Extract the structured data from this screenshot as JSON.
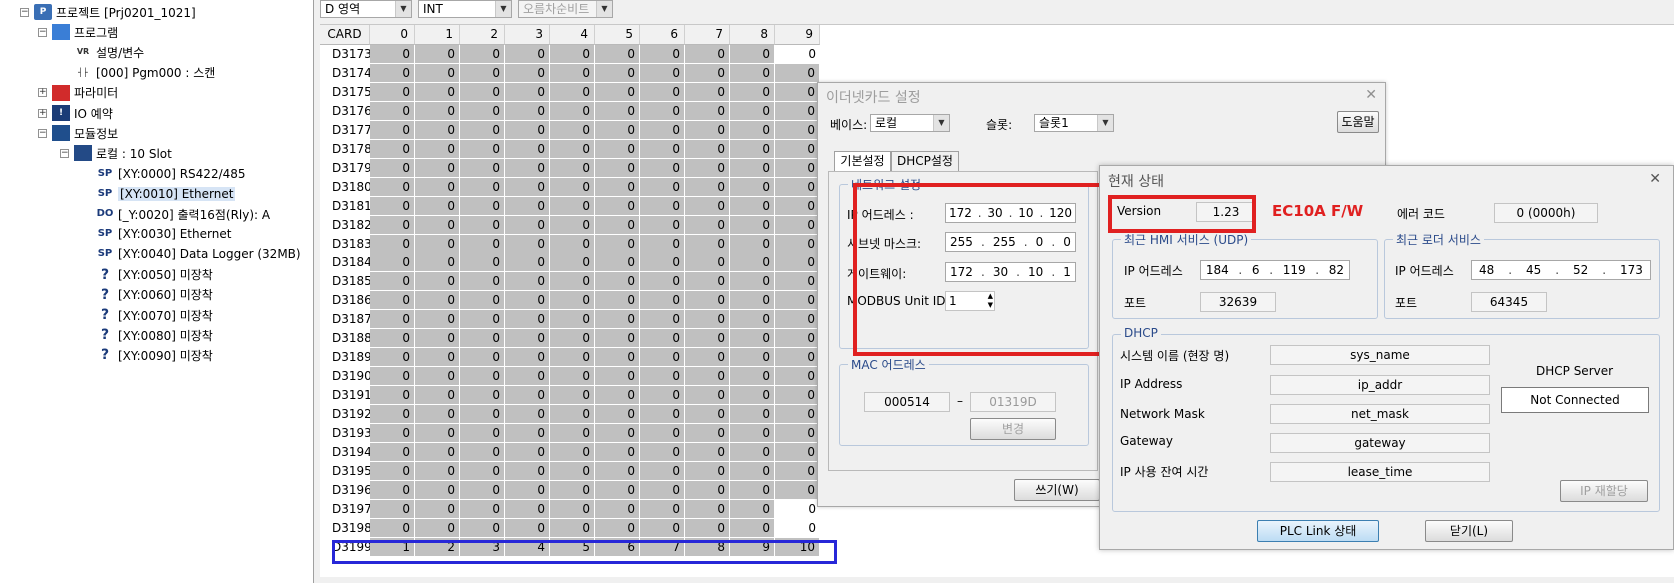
{
  "tree": {
    "items": [
      {
        "label": "프로젝트 [Prj0201_1021]",
        "icon": "project-icon",
        "box": "−"
      },
      {
        "label": "프로그램",
        "icon": "program-folder-icon",
        "box": "−"
      },
      {
        "label": "설명/변수",
        "icon": "variable-icon",
        "box": ""
      },
      {
        "label": "[000] Pgm000 : 스캔",
        "icon": "ladder-icon",
        "box": ""
      },
      {
        "label": "파라미터",
        "icon": "parameter-icon",
        "box": "+"
      },
      {
        "label": "IO 예약",
        "icon": "io-icon",
        "box": "+"
      },
      {
        "label": "모듈정보",
        "icon": "module-icon",
        "box": "−"
      },
      {
        "label": "로컬 : 10 Slot",
        "icon": "slot-icon",
        "box": "−"
      },
      {
        "label": "[XY:0000] RS422/485",
        "icon": "sp-icon",
        "box": ""
      },
      {
        "label": "[XY:0010] Ethernet",
        "icon": "sp-icon",
        "box": ""
      },
      {
        "label": "[_Y:0020] 출력16점(Rly): A",
        "icon": "do-icon",
        "box": ""
      },
      {
        "label": "[XY:0030] Ethernet",
        "icon": "sp-icon",
        "box": ""
      },
      {
        "label": "[XY:0040] Data Logger (32MB)",
        "icon": "sp-icon",
        "box": ""
      },
      {
        "label": "[XY:0050] 미장착",
        "icon": "question-icon",
        "box": ""
      },
      {
        "label": "[XY:0060] 미장착",
        "icon": "question-icon",
        "box": ""
      },
      {
        "label": "[XY:0070] 미장착",
        "icon": "question-icon",
        "box": ""
      },
      {
        "label": "[XY:0080] 미장착",
        "icon": "question-icon",
        "box": ""
      },
      {
        "label": "[XY:0090] 미장착",
        "icon": "question-icon",
        "box": ""
      }
    ],
    "selected_index": 9
  },
  "toolbar": {
    "area": "D 영역",
    "type": "INT",
    "order": "오름차순비트"
  },
  "grid": {
    "card_header": "CARD",
    "columns": [
      "0",
      "1",
      "2",
      "3",
      "4",
      "5",
      "6",
      "7",
      "8",
      "9"
    ],
    "rows": [
      {
        "addr": "D3173",
        "values": [
          "0",
          "0",
          "0",
          "0",
          "0",
          "0",
          "0",
          "0",
          "0",
          "0"
        ]
      },
      {
        "addr": "D3174",
        "values": [
          "0",
          "0",
          "0",
          "0",
          "0",
          "0",
          "0",
          "0",
          "0",
          "0"
        ]
      },
      {
        "addr": "D3175",
        "values": [
          "0",
          "0",
          "0",
          "0",
          "0",
          "0",
          "0",
          "0",
          "0",
          "0"
        ]
      },
      {
        "addr": "D3176",
        "values": [
          "0",
          "0",
          "0",
          "0",
          "0",
          "0",
          "0",
          "0",
          "0",
          "0"
        ]
      },
      {
        "addr": "D3177",
        "values": [
          "0",
          "0",
          "0",
          "0",
          "0",
          "0",
          "0",
          "0",
          "0",
          "0"
        ]
      },
      {
        "addr": "D3178",
        "values": [
          "0",
          "0",
          "0",
          "0",
          "0",
          "0",
          "0",
          "0",
          "0",
          "0"
        ]
      },
      {
        "addr": "D3179",
        "values": [
          "0",
          "0",
          "0",
          "0",
          "0",
          "0",
          "0",
          "0",
          "0",
          "0"
        ]
      },
      {
        "addr": "D3180",
        "values": [
          "0",
          "0",
          "0",
          "0",
          "0",
          "0",
          "0",
          "0",
          "0",
          "0"
        ]
      },
      {
        "addr": "D3181",
        "values": [
          "0",
          "0",
          "0",
          "0",
          "0",
          "0",
          "0",
          "0",
          "0",
          "0"
        ]
      },
      {
        "addr": "D3182",
        "values": [
          "0",
          "0",
          "0",
          "0",
          "0",
          "0",
          "0",
          "0",
          "0",
          "0"
        ]
      },
      {
        "addr": "D3183",
        "values": [
          "0",
          "0",
          "0",
          "0",
          "0",
          "0",
          "0",
          "0",
          "0",
          "0"
        ]
      },
      {
        "addr": "D3184",
        "values": [
          "0",
          "0",
          "0",
          "0",
          "0",
          "0",
          "0",
          "0",
          "0",
          "0"
        ]
      },
      {
        "addr": "D3185",
        "values": [
          "0",
          "0",
          "0",
          "0",
          "0",
          "0",
          "0",
          "0",
          "0",
          "0"
        ]
      },
      {
        "addr": "D3186",
        "values": [
          "0",
          "0",
          "0",
          "0",
          "0",
          "0",
          "0",
          "0",
          "0",
          "0"
        ]
      },
      {
        "addr": "D3187",
        "values": [
          "0",
          "0",
          "0",
          "0",
          "0",
          "0",
          "0",
          "0",
          "0",
          "0"
        ]
      },
      {
        "addr": "D3188",
        "values": [
          "0",
          "0",
          "0",
          "0",
          "0",
          "0",
          "0",
          "0",
          "0",
          "0"
        ]
      },
      {
        "addr": "D3189",
        "values": [
          "0",
          "0",
          "0",
          "0",
          "0",
          "0",
          "0",
          "0",
          "0",
          "0"
        ]
      },
      {
        "addr": "D3190",
        "values": [
          "0",
          "0",
          "0",
          "0",
          "0",
          "0",
          "0",
          "0",
          "0",
          "0"
        ]
      },
      {
        "addr": "D3191",
        "values": [
          "0",
          "0",
          "0",
          "0",
          "0",
          "0",
          "0",
          "0",
          "0",
          "0"
        ]
      },
      {
        "addr": "D3192",
        "values": [
          "0",
          "0",
          "0",
          "0",
          "0",
          "0",
          "0",
          "0",
          "0",
          "0"
        ]
      },
      {
        "addr": "D3193",
        "values": [
          "0",
          "0",
          "0",
          "0",
          "0",
          "0",
          "0",
          "0",
          "0",
          "0"
        ]
      },
      {
        "addr": "D3194",
        "values": [
          "0",
          "0",
          "0",
          "0",
          "0",
          "0",
          "0",
          "0",
          "0",
          "0"
        ]
      },
      {
        "addr": "D3195",
        "values": [
          "0",
          "0",
          "0",
          "0",
          "0",
          "0",
          "0",
          "0",
          "0",
          "0"
        ]
      },
      {
        "addr": "D3196",
        "values": [
          "0",
          "0",
          "0",
          "0",
          "0",
          "0",
          "0",
          "0",
          "0",
          "0"
        ]
      },
      {
        "addr": "D3197",
        "values": [
          "0",
          "0",
          "0",
          "0",
          "0",
          "0",
          "0",
          "0",
          "0",
          "0"
        ]
      },
      {
        "addr": "D3198",
        "values": [
          "0",
          "0",
          "0",
          "0",
          "0",
          "0",
          "0",
          "0",
          "0",
          "0"
        ]
      },
      {
        "addr": "D3199",
        "values": [
          "1",
          "2",
          "3",
          "4",
          "5",
          "6",
          "7",
          "8",
          "9",
          "10"
        ]
      }
    ]
  },
  "ethernet_dialog": {
    "title": "이더넷카드 설정",
    "close": "✕",
    "base_label": "베이스:",
    "base_value": "로컬",
    "slot_label": "슬롯:",
    "slot_value": "슬롯1",
    "help_button": "도움말",
    "tab_basic": "기본설정",
    "tab_dhcp": "DHCP설정",
    "network_group": "네트워크 설정",
    "ip_label": "IP 어드레스 :",
    "ip": [
      "172",
      "30",
      "10",
      "120"
    ],
    "subnet_label": "서브넷 마스크:",
    "subnet": [
      "255",
      "255",
      "0",
      "0"
    ],
    "gateway_label": "게이트웨이:",
    "gateway": [
      "172",
      "30",
      "10",
      "1"
    ],
    "modbus_label": "MODBUS Unit ID:",
    "modbus_value": "1",
    "mac_group": "MAC 어드레스",
    "mac_left": "000514",
    "mac_dash": "–",
    "mac_right": "01319D",
    "change_button": "변경",
    "write_button": "쓰기(W)"
  },
  "status_dialog": {
    "title": "현재 상태",
    "close": "✕",
    "version_label": "Version",
    "version_value": "1.23",
    "fw_note": "EC10A F/W",
    "error_label": "에러 코드",
    "error_value": "0 (0000h)",
    "hmi_group": "최근 HMI 서비스 (UDP)",
    "hmi_ip_label": "IP 어드레스",
    "hmi_ip": [
      "184",
      "6",
      "119",
      "82"
    ],
    "hmi_port_label": "포트",
    "hmi_port": "32639",
    "loader_group": "최근 로더 서비스",
    "loader_ip_label": "IP 어드레스",
    "loader_ip": [
      "48",
      "45",
      "52",
      "173"
    ],
    "loader_port_label": "포트",
    "loader_port": "64345",
    "dhcp_group": "DHCP",
    "sysname_label": "시스템 이름 (현장 명)",
    "sysname_value": "sys_name",
    "ipaddr_label": "IP Address",
    "ipaddr_value": "ip_addr",
    "netmask_label": "Network Mask",
    "netmask_value": "net_mask",
    "gw_label": "Gateway",
    "gw_value": "gateway",
    "lease_label": "IP 사용 잔여 시간",
    "lease_value": "lease_time",
    "dhcp_server_label": "DHCP Server",
    "dhcp_server_status": "Not Connected",
    "reassign_button": "IP 재할당",
    "plc_link_button": "PLC Link 상태",
    "close_button": "닫기(L)"
  },
  "colors": {
    "highlight_red": "#e02020",
    "highlight_blue": "#2727d8"
  }
}
